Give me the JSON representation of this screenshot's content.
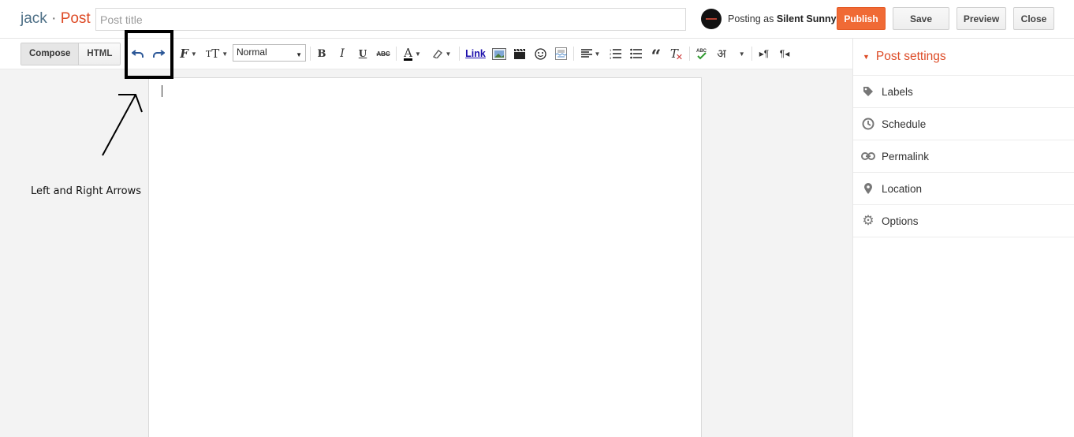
{
  "header": {
    "blog_name": "jack",
    "separator": "·",
    "section": "Post",
    "title_placeholder": "Post title",
    "title_value": "",
    "posting_as_prefix": "Posting as",
    "user_name": "Silent Sunny",
    "buttons": {
      "publish": "Publish",
      "save": "Save",
      "preview": "Preview",
      "close": "Close"
    }
  },
  "toolbar": {
    "modes": [
      "Compose",
      "HTML"
    ],
    "active_mode": "Compose",
    "format_value": "Normal",
    "bold": "B",
    "italic": "I",
    "underline": "U",
    "strike": "ABC",
    "link": "Link",
    "hindi": "अ",
    "icons": [
      "undo-icon",
      "redo-icon",
      "font-family-icon",
      "font-size-icon",
      "bold-icon",
      "italic-icon",
      "underline-icon",
      "strikethrough-icon",
      "text-color-icon",
      "highlight-icon",
      "link-icon",
      "image-icon",
      "video-icon",
      "emoji-icon",
      "jump-break-icon",
      "align-icon",
      "numbered-list-icon",
      "bullet-list-icon",
      "quote-icon",
      "remove-format-icon",
      "spellcheck-icon",
      "input-tools-icon",
      "ltr-icon",
      "rtl-icon"
    ]
  },
  "annotation": {
    "text": "Left and Right Arrows"
  },
  "sidebar": {
    "title": "Post settings",
    "items": [
      {
        "label": "Labels",
        "icon": "tag-icon"
      },
      {
        "label": "Schedule",
        "icon": "clock-icon"
      },
      {
        "label": "Permalink",
        "icon": "link-chain-icon"
      },
      {
        "label": "Location",
        "icon": "location-pin-icon"
      },
      {
        "label": "Options",
        "icon": "gear-icon"
      }
    ]
  },
  "colors": {
    "accent": "#dd4b26",
    "publish": "#f06a35",
    "blog_name": "#4d6f86",
    "editor_bg": "#f3f3f3"
  }
}
